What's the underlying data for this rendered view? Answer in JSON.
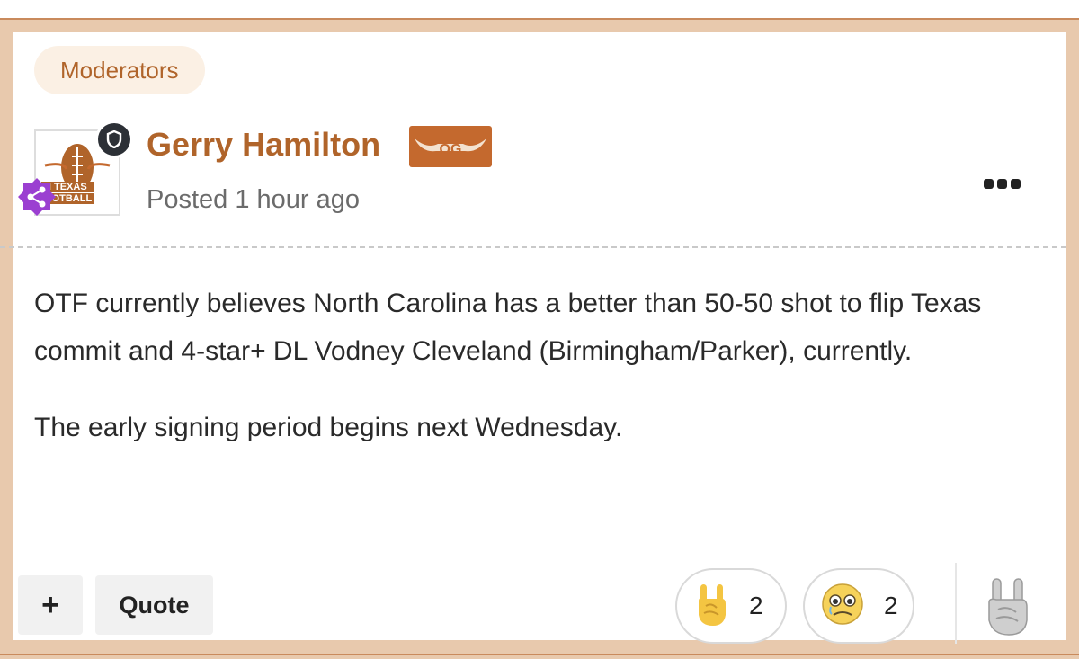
{
  "post": {
    "role_badge": "Moderators",
    "author": "Gerry Hamilton",
    "author_badge": "OG",
    "avatar_text": [
      "N TEXAS",
      "OOTBALL"
    ],
    "posted": "Posted 1 hour ago",
    "paragraphs": [
      "OTF currently believes North Carolina has a better than 50-50 shot to flip Texas commit and 4-star+ DL Vodney Cleveland (Birmingham/Parker), currently.",
      "The early signing period begins next Wednesday."
    ]
  },
  "actions": {
    "plus_label": "+",
    "quote_label": "Quote"
  },
  "reactions": [
    {
      "icon": "rock-on-hand-icon",
      "count": "2"
    },
    {
      "icon": "crying-face-icon",
      "count": "2"
    }
  ],
  "colors": {
    "accent": "#b0642a",
    "frame": "#e8c9ad",
    "og_badge": "#c4692e",
    "share_badge": "#9b3fd1"
  }
}
